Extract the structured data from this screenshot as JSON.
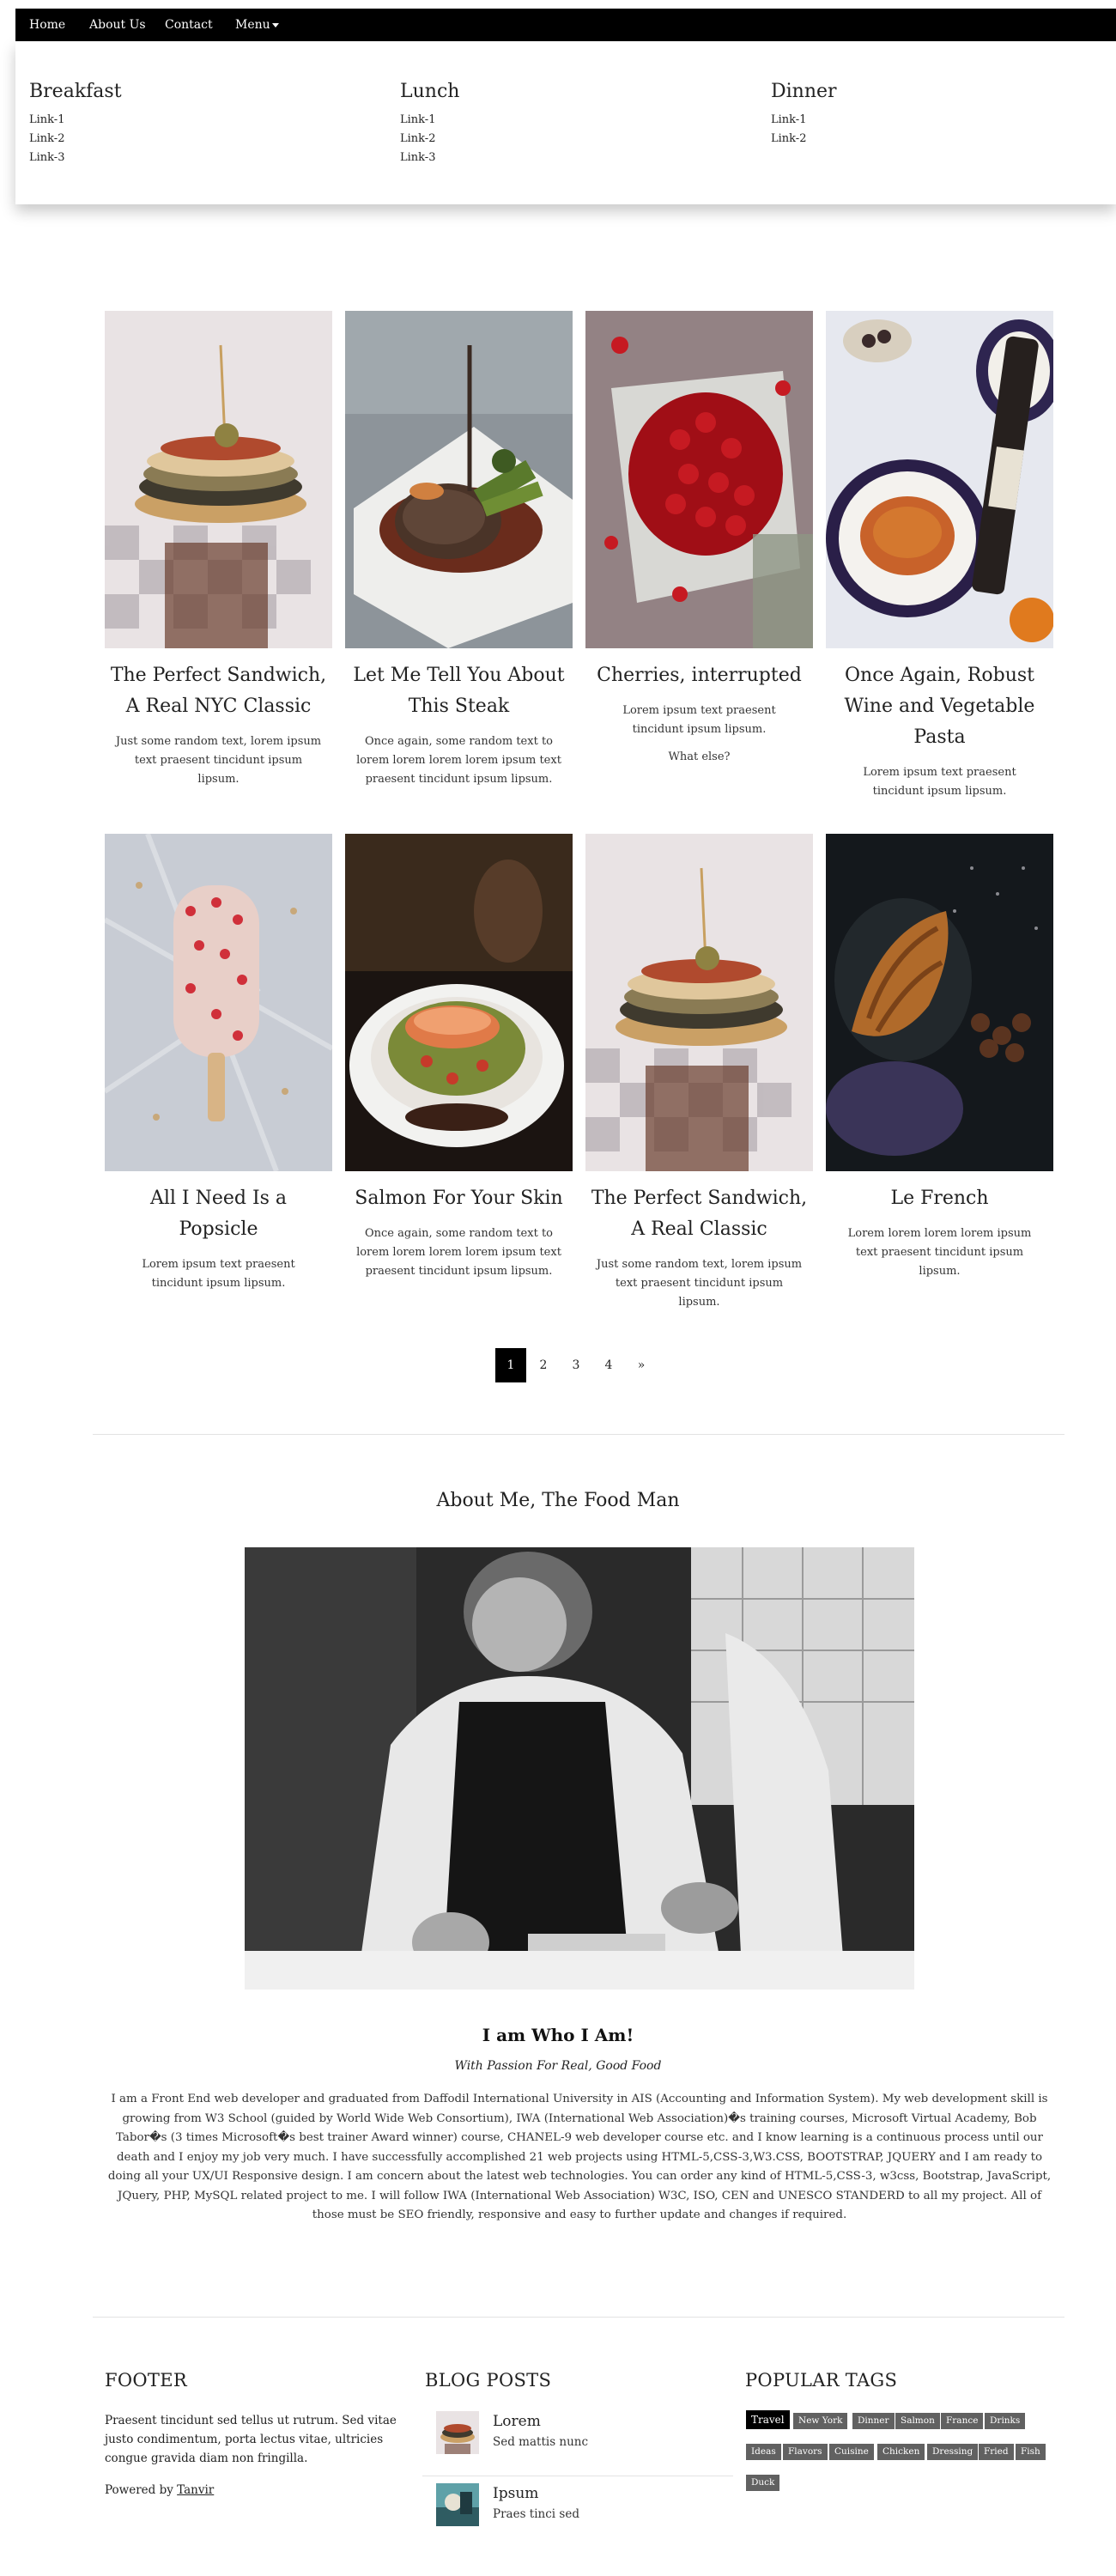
{
  "nav": {
    "items": [
      "Home",
      "About Us",
      "Contact"
    ],
    "menu_label": "Menu"
  },
  "mega_menu": {
    "columns": [
      {
        "title": "Breakfast",
        "links": [
          "Link-1",
          "Link-2",
          "Link-3"
        ]
      },
      {
        "title": "Lunch",
        "links": [
          "Link-1",
          "Link-2",
          "Link-3"
        ]
      },
      {
        "title": "Dinner",
        "links": [
          "Link-1",
          "Link-2"
        ]
      }
    ]
  },
  "cards": [
    {
      "title": "The Perfect Sandwich, A Real NYC Classic",
      "text": "Just some random text, lorem ipsum text praesent tincidunt ipsum lipsum.",
      "text2": ""
    },
    {
      "title": "Let Me Tell You About This Steak",
      "text": "Once again, some random text to lorem lorem lorem lorem ipsum text praesent tincidunt ipsum lipsum.",
      "text2": ""
    },
    {
      "title": "Cherries, interrupted",
      "text": "Lorem ipsum text praesent tincidunt ipsum lipsum.",
      "text2": "What else?"
    },
    {
      "title": "Once Again, Robust Wine and Vegetable Pasta",
      "text": "Lorem ipsum text praesent tincidunt ipsum lipsum.",
      "text2": ""
    },
    {
      "title": "All I Need Is a Popsicle",
      "text": "Lorem ipsum text praesent tincidunt ipsum lipsum.",
      "text2": ""
    },
    {
      "title": "Salmon For Your Skin",
      "text": "Once again, some random text to lorem lorem lorem lorem ipsum text praesent tincidunt ipsum lipsum.",
      "text2": ""
    },
    {
      "title": "The Perfect Sandwich, A Real Classic",
      "text": "Just some random text, lorem ipsum text praesent tincidunt ipsum lipsum.",
      "text2": ""
    },
    {
      "title": "Le French",
      "text": "Lorem lorem lorem lorem ipsum text praesent tincidunt ipsum lipsum.",
      "text2": ""
    }
  ],
  "pagination": {
    "pages": [
      "1",
      "2",
      "3",
      "4"
    ],
    "next": "»",
    "active": "1"
  },
  "about": {
    "title": "About Me, The Food Man",
    "name": "I am Who I Am!",
    "tagline": "With Passion For Real, Good Food",
    "text": "I am a Front End web developer and graduated from Daffodil International University in AIS (Accounting and Information System). My web development skill is growing from W3 School (guided by World Wide Web Consortium), IWA (International Web Association)�s training courses, Microsoft Virtual Academy, Bob Tabor�s (3 times Microsoft�s best trainer Award winner) course, CHANEL-9 web developer course etc. and I know learning is a continuous process until our death and I enjoy my job very much. I have successfully accomplished 21 web projects using HTML-5,CSS-3,W3.CSS, BOOTSTRAP, JQUERY and I am ready to doing all your UX/UI Responsive design. I am concern about the latest web technologies. You can order any kind of HTML-5,CSS-3, w3css, Bootstrap, JavaScript, JQuery, PHP, MySQL related project to me. I will follow IWA (International Web Association) W3C, ISO, CEN and UNESCO STANDERD to all my project. All of those must be SEO friendly, responsive and easy to further update and changes if required."
  },
  "footer": {
    "title": "FOOTER",
    "text": "Praesent tincidunt sed tellus ut rutrum. Sed vitae justo condimentum, porta lectus vitae, ultricies congue gravida diam non fringilla.",
    "powered_prefix": "Powered by",
    "powered_link": "Tanvir"
  },
  "blog": {
    "title": "BLOG POSTS",
    "posts": [
      {
        "title": "Lorem",
        "subtitle": "Sed mattis nunc"
      },
      {
        "title": "Ipsum",
        "subtitle": "Praes tinci sed"
      }
    ]
  },
  "tags": {
    "title": "POPULAR TAGS",
    "items": [
      "Travel",
      "New York",
      "Dinner",
      "Salmon",
      "France",
      "Drinks",
      "Ideas",
      "Flavors",
      "Cuisine",
      "Chicken",
      "Dressing",
      "Fried",
      "Fish",
      "Duck"
    ],
    "active": "Travel"
  }
}
